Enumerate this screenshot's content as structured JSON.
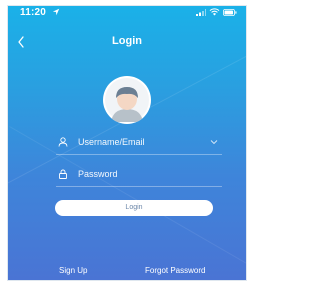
{
  "status_bar": {
    "time": "11:20",
    "location_icon": "location-arrow-icon",
    "signal_icon": "signal-bars-icon",
    "wifi_icon": "wifi-icon",
    "battery_icon": "battery-icon"
  },
  "nav": {
    "title": "Login",
    "back_icon": "chevron-left-icon"
  },
  "form": {
    "username_placeholder": "Username/Email",
    "password_placeholder": "Password",
    "login_label": "Login"
  },
  "links": {
    "sign_up": "Sign Up",
    "forgot_password": "Forgot Password"
  },
  "colors": {
    "gradient_top": "#1ab1e8",
    "gradient_bottom": "#4a74d4",
    "button_bg": "#ffffff",
    "button_text": "#6b86a8"
  }
}
